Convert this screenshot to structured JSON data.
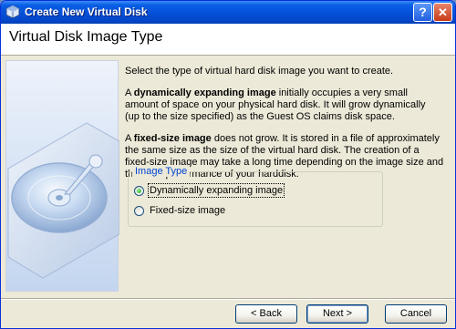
{
  "window": {
    "title": "Create New Virtual Disk",
    "help_button": "?",
    "close_button": "✕"
  },
  "header": {
    "title": "Virtual Disk Image Type"
  },
  "content": {
    "intro": "Select the type of virtual hard disk image you want to create.",
    "dynamic": {
      "bold": "dynamically expanding image",
      "before": "A ",
      "after": " initially occupies a very small amount of space on your physical hard disk. It will grow dynamically (up to the size specified) as the Guest OS claims disk space."
    },
    "fixed": {
      "before": "A ",
      "bold": "fixed-size image",
      "after": " does not grow. It is stored in a file of approximately the same size as the size of the virtual hard disk. The creation of a fixed-size image may take a long time depending on the image size and the write performance of your harddisk."
    }
  },
  "image_type_group": {
    "legend": "Image Type",
    "options": [
      {
        "label": "Dynamically expanding image",
        "checked": true
      },
      {
        "label": "Fixed-size image",
        "checked": false
      }
    ]
  },
  "buttons": {
    "back": "< Back",
    "next": "Next >",
    "cancel": "Cancel"
  },
  "icons": {
    "app": "virtualbox-icon",
    "side_image": "hard-disk-illustration"
  },
  "colors": {
    "titlebar": "#0450d8",
    "group_legend": "#0046d5",
    "dialog_bg": "#ece9d8"
  }
}
